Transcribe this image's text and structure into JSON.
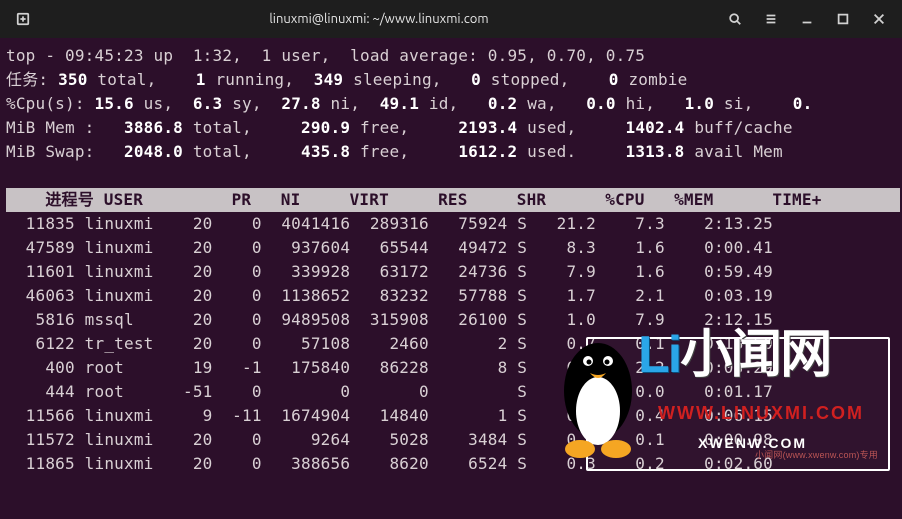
{
  "titlebar": {
    "title": "linuxmi@linuxmi: ~/www.linuxmi.com"
  },
  "top": {
    "prefix": "top - ",
    "time": "09:45:23",
    "up_label": " up  ",
    "uptime": "1:32",
    "users_sep": ",  ",
    "users": "1 user",
    "load_label": ",  load average: ",
    "load": "0.95, 0.70, 0.75"
  },
  "tasks": {
    "label": "任务:",
    "total": "350",
    "total_label": "total,",
    "running": "1",
    "running_label": "running,",
    "sleeping": "349",
    "sleeping_label": "sleeping,",
    "stopped": "0",
    "stopped_label": "stopped,",
    "zombie": "0",
    "zombie_label": "zombie"
  },
  "cpu": {
    "label": "%Cpu(s):",
    "us": "15.6",
    "us_label": "us,",
    "sy": "6.3",
    "sy_label": "sy,",
    "ni": "27.8",
    "ni_label": "ni,",
    "id": "49.1",
    "id_label": "id,",
    "wa": "0.2",
    "wa_label": "wa,",
    "hi": "0.0",
    "hi_label": "hi,",
    "si": "1.0",
    "si_label": "si,",
    "st": "0.",
    "st_label": ""
  },
  "mem": {
    "label": "MiB Mem :",
    "total": "3886.8",
    "total_label": "total,",
    "free": "290.9",
    "free_label": "free,",
    "used": "2193.4",
    "used_label": "used,",
    "cache": "1402.4",
    "cache_label": "buff/cache"
  },
  "swap": {
    "label": "MiB Swap:",
    "total": "2048.0",
    "total_label": "total,",
    "free": "435.8",
    "free_label": "free,",
    "used": "1612.2",
    "used_label": "used.",
    "avail": "1313.8",
    "avail_label": "avail Mem"
  },
  "columns": [
    "进程号",
    "USER",
    "PR",
    "NI",
    "VIRT",
    "RES",
    "SHR",
    "",
    "%CPU",
    "%MEM",
    "TIME+"
  ],
  "rows": [
    {
      "pid": "11835",
      "user": "linuxmi",
      "pr": "20",
      "ni": "0",
      "virt": "4041416",
      "res": "289316",
      "shr": "75924",
      "s": "S",
      "cpu": "21.2",
      "mem": "7.3",
      "time": "2:13.25"
    },
    {
      "pid": "47589",
      "user": "linuxmi",
      "pr": "20",
      "ni": "0",
      "virt": "937604",
      "res": "65544",
      "shr": "49472",
      "s": "S",
      "cpu": "8.3",
      "mem": "1.6",
      "time": "0:00.41"
    },
    {
      "pid": "11601",
      "user": "linuxmi",
      "pr": "20",
      "ni": "0",
      "virt": "339928",
      "res": "63172",
      "shr": "24736",
      "s": "S",
      "cpu": "7.9",
      "mem": "1.6",
      "time": "0:59.49"
    },
    {
      "pid": "46063",
      "user": "linuxmi",
      "pr": "20",
      "ni": "0",
      "virt": "1138652",
      "res": "83232",
      "shr": "57788",
      "s": "S",
      "cpu": "1.7",
      "mem": "2.1",
      "time": "0:03.19"
    },
    {
      "pid": "5816",
      "user": "mssql",
      "pr": "20",
      "ni": "0",
      "virt": "9489508",
      "res": "315908",
      "shr": "26100",
      "s": "S",
      "cpu": "1.0",
      "mem": "7.9",
      "time": "2:12.15"
    },
    {
      "pid": "6122",
      "user": "tr_test",
      "pr": "20",
      "ni": "0",
      "virt": "57108",
      "res": "2460",
      "shr": "2",
      "s": "S",
      "cpu": "0.7",
      "mem": "0.1",
      "time": "0:18.50"
    },
    {
      "pid": "400",
      "user": "root",
      "pr": "19",
      "ni": "-1",
      "virt": "175840",
      "res": "86228",
      "shr": "8",
      "s": "S",
      "cpu": "0.3",
      "mem": "2.2",
      "time": "0:03.29"
    },
    {
      "pid": "444",
      "user": "root",
      "pr": "-51",
      "ni": "0",
      "virt": "0",
      "res": "0",
      "shr": "",
      "s": "S",
      "cpu": "0.3",
      "mem": "0.0",
      "time": "0:01.17"
    },
    {
      "pid": "11566",
      "user": "linuxmi",
      "pr": "9",
      "ni": "-11",
      "virt": "1674904",
      "res": "14840",
      "shr": "1",
      "s": "S",
      "cpu": "0.3",
      "mem": "0.4",
      "time": "0:06.15"
    },
    {
      "pid": "11572",
      "user": "linuxmi",
      "pr": "20",
      "ni": "0",
      "virt": "9264",
      "res": "5028",
      "shr": "3484",
      "s": "S",
      "cpu": "0.3",
      "mem": "0.1",
      "time": "0:00.98"
    },
    {
      "pid": "11865",
      "user": "linuxmi",
      "pr": "20",
      "ni": "0",
      "virt": "388656",
      "res": "8620",
      "shr": "6524",
      "s": "S",
      "cpu": "0.3",
      "mem": "0.2",
      "time": "0:02.60"
    }
  ],
  "watermark": {
    "big1": "Li",
    "big2": "小闻网",
    "url": "WWW.LINUXMI.COM",
    "sub": "XWENW.COM",
    "tiny": "小闻网(www.xwenw.com)专用"
  }
}
